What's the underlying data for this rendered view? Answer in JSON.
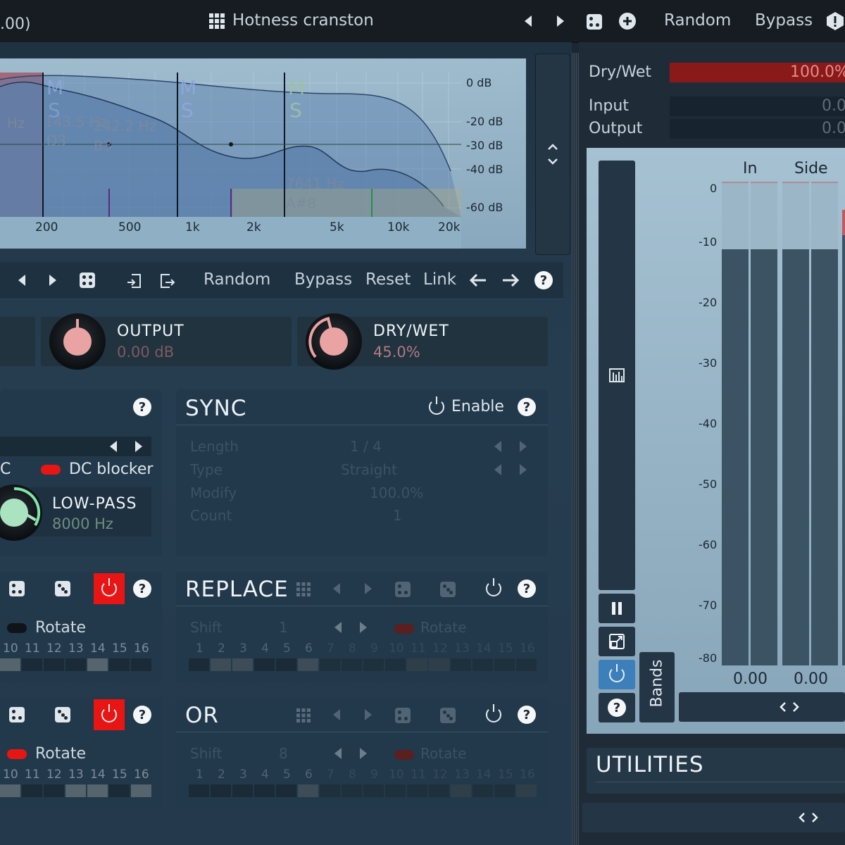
{
  "header": {
    "left_fragment": ".00)",
    "preset_name": "Hotness cranston",
    "random_label": "Random",
    "bypass_label": "Bypass"
  },
  "analyzer": {
    "db_labels": [
      "0 dB",
      "-20 dB",
      "-30 dB",
      "-40 dB",
      "-60 dB"
    ],
    "freq_labels": [
      "200",
      "500",
      "1k",
      "2k",
      "5k",
      "10k",
      "20k"
    ],
    "band_labels": {
      "b1_hz": "Hz",
      "b2_hz": "143.5 Hz",
      "b2_note": "D3",
      "b3_hz": "242.2 Hz",
      "b3_note": "B3",
      "b4_hz": "7641 Hz",
      "b4_note": "A#8"
    },
    "ms_letters": [
      "M",
      "S"
    ]
  },
  "toolbar": {
    "random_label": "Random",
    "bypass_label": "Bypass",
    "reset_label": "Reset",
    "link_label": "Link"
  },
  "knobs": {
    "output": {
      "title": "OUTPUT",
      "value": "0.00 dB"
    },
    "drywet": {
      "title": "DRY/WET",
      "value": "45.0%"
    }
  },
  "filter_panel": {
    "dc_fragment": "C",
    "dc_blocker_label": "DC blocker",
    "lowpass_title": "LOW-PASS",
    "lowpass_value": "8000 Hz"
  },
  "sync": {
    "title": "SYNC",
    "enable_label": "Enable",
    "rows": [
      {
        "label": "Length",
        "value": "1 / 4"
      },
      {
        "label": "Type",
        "value": "Straight"
      },
      {
        "label": "Modify",
        "value": "100.0%"
      },
      {
        "label": "Count",
        "value": "1"
      }
    ]
  },
  "seq_left_a": {
    "rotate_label": "Rotate",
    "steps": [
      "10",
      "11",
      "12",
      "13",
      "14",
      "15",
      "16"
    ]
  },
  "replace": {
    "title": "REPLACE",
    "shift_label": "Shift",
    "shift_value": "1",
    "rotate_label": "Rotate",
    "steps": [
      "1",
      "2",
      "3",
      "4",
      "5",
      "6",
      "7",
      "8",
      "9",
      "10",
      "11",
      "12",
      "13",
      "14",
      "15",
      "16"
    ]
  },
  "seq_left_b": {
    "rotate_label": "Rotate",
    "steps": [
      "10",
      "11",
      "12",
      "13",
      "14",
      "15",
      "16"
    ]
  },
  "or_panel": {
    "title": "OR",
    "shift_label": "Shift",
    "shift_value": "8",
    "rotate_label": "Rotate",
    "steps": [
      "1",
      "2",
      "3",
      "4",
      "5",
      "6",
      "7",
      "8",
      "9",
      "10",
      "11",
      "12",
      "13",
      "14",
      "15",
      "16"
    ]
  },
  "right": {
    "drywet_label": "Dry/Wet",
    "drywet_value": "100.0%",
    "input_label": "Input",
    "input_value": "0.0",
    "output_label": "Output",
    "output_value": "0.0",
    "meter_headers": [
      "In",
      "Side"
    ],
    "meter_scale": [
      "0",
      "-10",
      "-20",
      "-30",
      "-40",
      "-50",
      "-60",
      "-70",
      "-80"
    ],
    "meter_values": [
      "0.00",
      "0.00"
    ],
    "bands_label": "Bands",
    "utilities_title": "UTILITIES"
  },
  "colors": {
    "accent_red": "#e81515",
    "drywet_bar": "#8a1a1a",
    "knob_pink": "#e9a3a3",
    "knob_green": "#a9e3bf"
  }
}
